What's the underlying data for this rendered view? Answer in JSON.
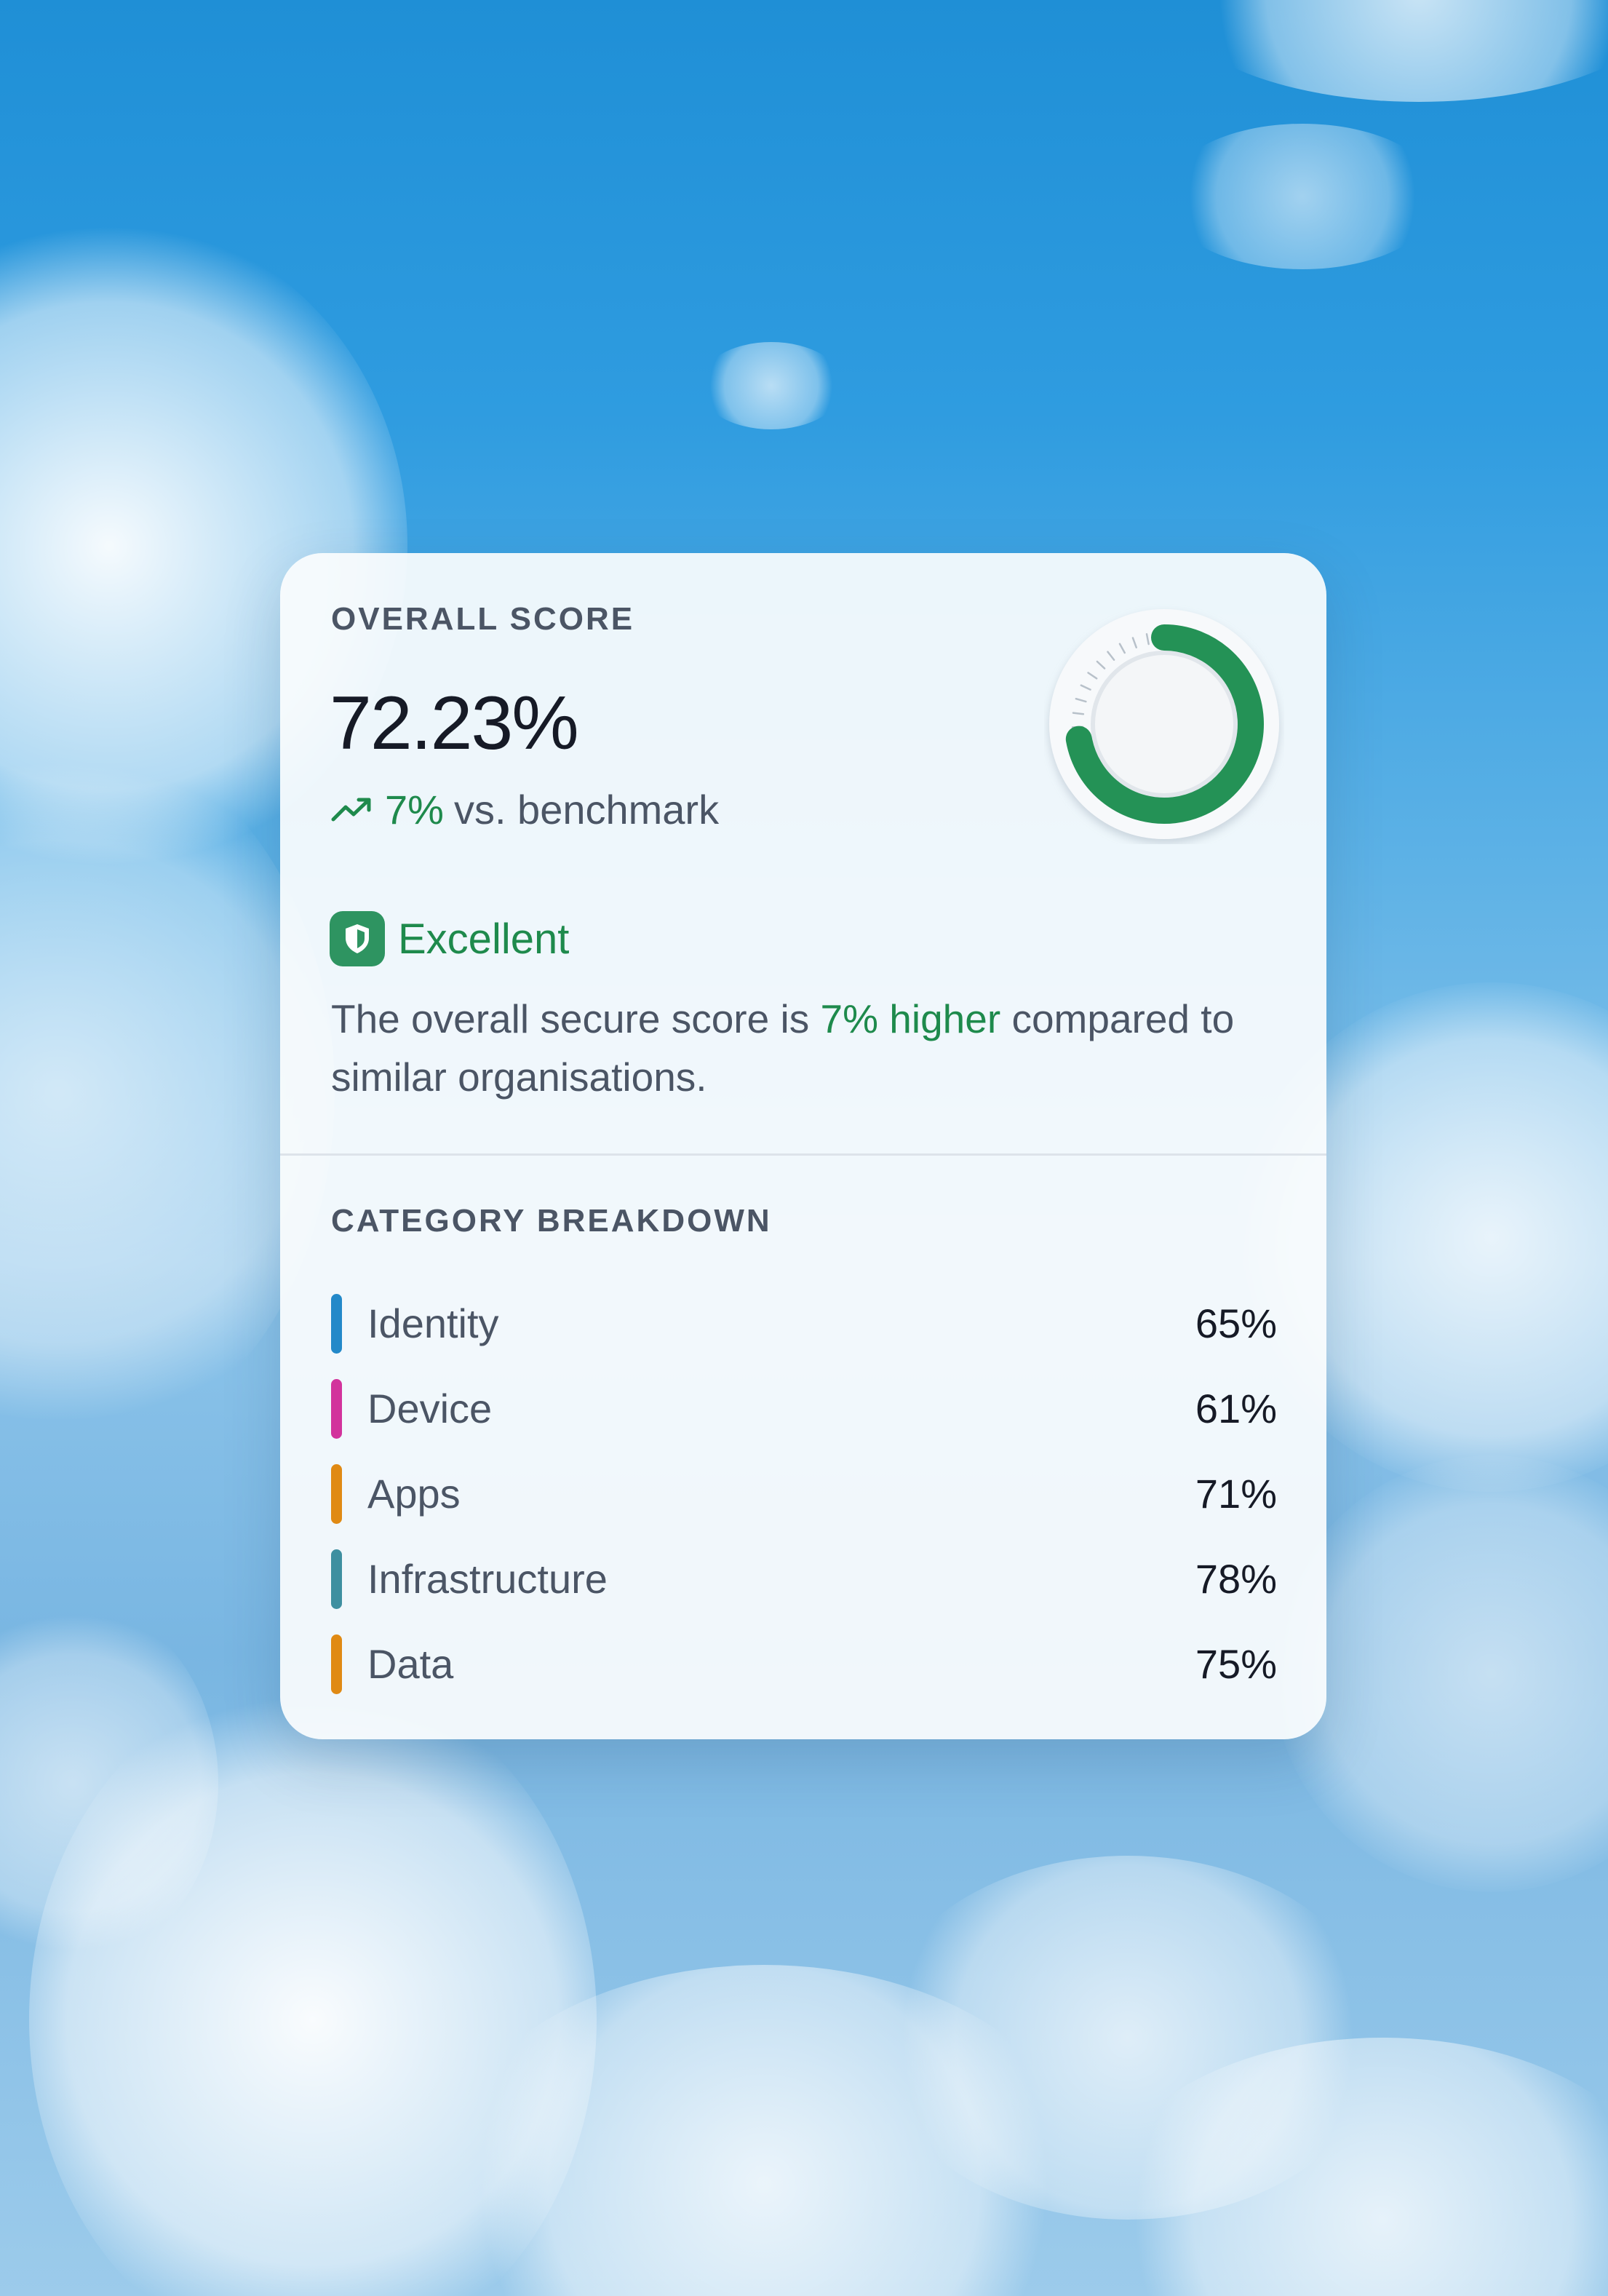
{
  "overall": {
    "label": "OVERALL SCORE",
    "score": "72.23%",
    "score_value": 72.23,
    "trend_pct": "7%",
    "trend_text": "vs. benchmark",
    "rating": "Excellent",
    "desc_before": "The overall secure score is ",
    "desc_highlight": "7% higher",
    "desc_after": " compared to similar organisations."
  },
  "categories": {
    "label": "CATEGORY BREAKDOWN",
    "items": [
      {
        "name": "Identity",
        "value": "65%",
        "color": "#2389c9"
      },
      {
        "name": "Device",
        "value": "61%",
        "color": "#d2339c"
      },
      {
        "name": "Apps",
        "value": "71%",
        "color": "#e08a14"
      },
      {
        "name": "Infrastructure",
        "value": "78%",
        "color": "#3e8fa0"
      },
      {
        "name": "Data",
        "value": "75%",
        "color": "#e08a14"
      }
    ]
  },
  "colors": {
    "accent_green": "#1e8a4c",
    "gauge_green": "#249256",
    "text_dark": "#161a26",
    "text_muted": "#4b5565"
  },
  "icons": {
    "trend": "trending-up-icon",
    "badge": "shield-icon"
  }
}
